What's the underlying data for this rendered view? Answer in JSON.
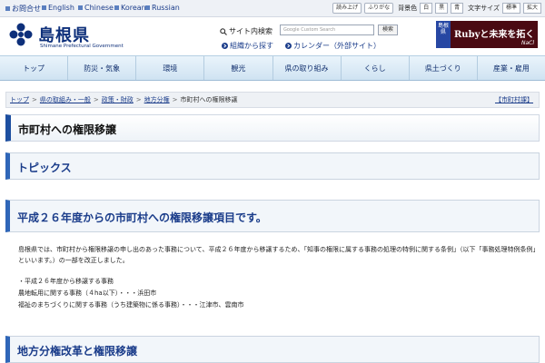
{
  "utility": {
    "langs": [
      "お問合せ",
      "English",
      "Chinese",
      "Korean",
      "Russian"
    ],
    "buttons": [
      "読み上げ",
      "ふりがな"
    ],
    "bg_label": "背景色",
    "bg_options": [
      "白",
      "黒",
      "青"
    ],
    "size_label": "文字サイズ",
    "size_options": [
      "標準",
      "拡大"
    ]
  },
  "header": {
    "site_title": "島根県",
    "site_subtitle": "Shimane Prefectural Government",
    "search_label": "サイト内検索",
    "search_placeholder": "Google Custom Search",
    "search_button": "検索",
    "link_org": "組織から探す",
    "link_calendar": "カレンダー（外部サイト）",
    "banner": {
      "vertical": "島根県",
      "title": "Rubyと未来を拓く",
      "sub": "NaCl"
    }
  },
  "nav": [
    "トップ",
    "防災・気象",
    "環境",
    "観光",
    "県の取り組み",
    "くらし",
    "県土づくり",
    "産業・雇用"
  ],
  "breadcrumb": {
    "items": [
      "トップ",
      "県の取組み・一般",
      "政策・財政",
      "地方分権"
    ],
    "current": "市町村への権限移譲",
    "right": "【市町村課】"
  },
  "page": {
    "title": "市町村への権限移譲",
    "topics": "トピックス",
    "list_heading": "平成２６年度からの市町村への権限移譲項目です。",
    "paragraph": "島根県では、市町村から権限移譲の申し出のあった事務について、平成２６年度から移譲するため、「知事の権限に属する事務の処理の特例に関する条例」（以下「事務処理特例条例」といいます。）の一部を改正しました。",
    "list_title": "・平成２６年度から移譲する事務",
    "list_items": [
      "農地転用に関する事務（４ha以下）・・・浜田市",
      "福祉のまちづくりに関する事務（うち建築物に係る事務）・・・江津市、雲南市"
    ],
    "reform_heading": "地方分権改革と権限移譲"
  },
  "colors": {
    "brand": "#0d2f7a",
    "accent": "#2f66b8",
    "nav_bg": "#cfe3f2"
  }
}
